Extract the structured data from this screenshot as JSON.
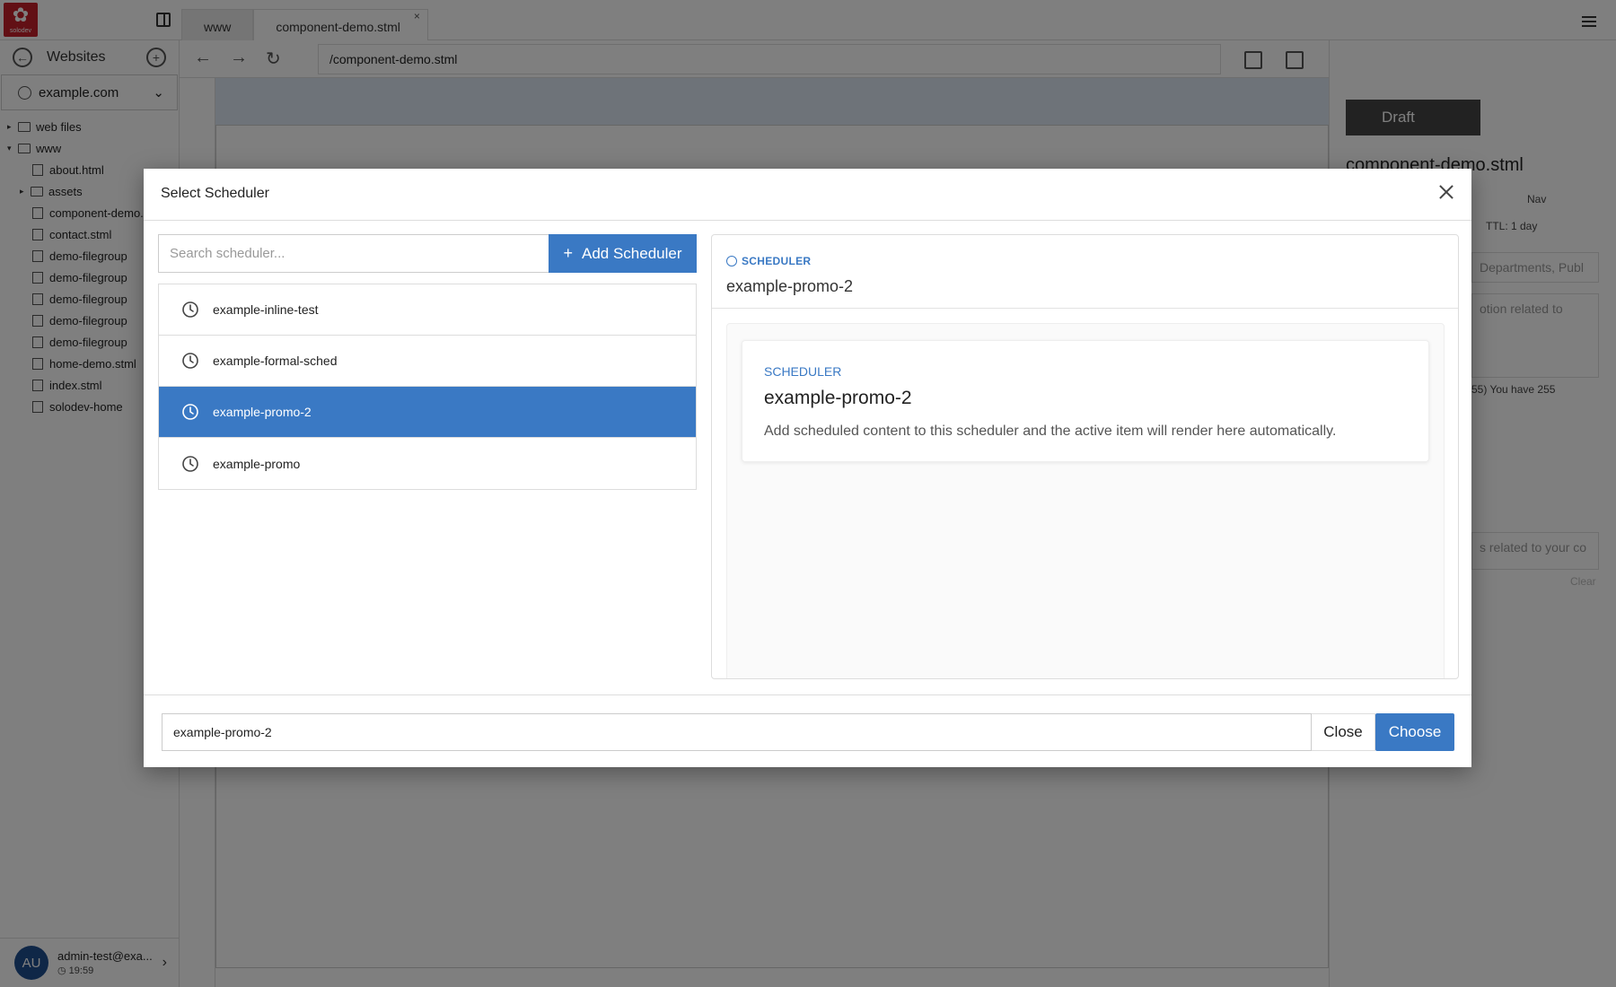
{
  "app": {
    "logo_text": "solodev",
    "tabs": [
      {
        "label": "www"
      },
      {
        "label": "component-demo.stml",
        "close": "×"
      }
    ]
  },
  "sidebar": {
    "title": "Websites",
    "site": "example.com",
    "tree": [
      {
        "label": "web files",
        "type": "folder",
        "level": 0,
        "toggle": "▸"
      },
      {
        "label": "www",
        "type": "folder",
        "level": 0,
        "toggle": "▾"
      },
      {
        "label": "about.html",
        "type": "file",
        "level": 1
      },
      {
        "label": "assets",
        "type": "folder",
        "level": 1,
        "toggle": "▸"
      },
      {
        "label": "component-demo.stml",
        "type": "page",
        "level": 1
      },
      {
        "label": "contact.stml",
        "type": "page",
        "level": 1
      },
      {
        "label": "demo-filegroup",
        "type": "page",
        "level": 1
      },
      {
        "label": "demo-filegroup",
        "type": "page",
        "level": 1
      },
      {
        "label": "demo-filegroup",
        "type": "page",
        "level": 1
      },
      {
        "label": "demo-filegroup",
        "type": "page",
        "level": 1
      },
      {
        "label": "demo-filegroup",
        "type": "page",
        "level": 1
      },
      {
        "label": "home-demo.stml",
        "type": "page",
        "level": 1
      },
      {
        "label": "index.stml",
        "type": "page",
        "level": 1
      },
      {
        "label": "solodev-home",
        "type": "link",
        "level": 1
      }
    ],
    "user": {
      "initials": "AU",
      "email": "admin-test@exa...",
      "time": "19:59"
    }
  },
  "toolbar": {
    "url": "/component-demo.stml"
  },
  "right_panel": {
    "status": "Draft",
    "file_title": "component-demo.stml",
    "nav_label": "Nav",
    "ttl": "TTL: 1 day",
    "categories_placeholder": "Departments, Publ",
    "description_placeholder": "otion related to",
    "char_count": "55) You have 255",
    "tags_placeholder": "s related to your co",
    "clear": "Clear"
  },
  "modal": {
    "title": "Select Scheduler",
    "search": {
      "placeholder": "Search scheduler..."
    },
    "add_button": "Add Scheduler",
    "items": [
      {
        "label": "example-inline-test",
        "selected": false
      },
      {
        "label": "example-formal-sched",
        "selected": false
      },
      {
        "label": "example-promo-2",
        "selected": true
      },
      {
        "label": "example-promo",
        "selected": false
      }
    ],
    "preview": {
      "tag": "SCHEDULER",
      "name": "example-promo-2",
      "card_tag": "SCHEDULER",
      "card_name": "example-promo-2",
      "card_desc": "Add scheduled content to this scheduler and the active item will render here automatically."
    },
    "selected_value": "example-promo-2",
    "close_label": "Close",
    "choose_label": "Choose"
  },
  "colors": {
    "accent": "#3a79c4",
    "brand": "#c4212a",
    "overlay": "rgba(0,0,0,0.5)"
  }
}
